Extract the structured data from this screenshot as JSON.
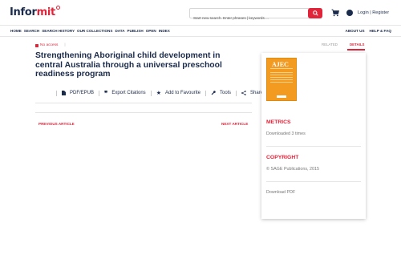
{
  "header": {
    "logo_part1": "Infor",
    "logo_part2": "mit",
    "search_placeholder": "Start new search. Enter phrases | keywords ...",
    "login_label": "Login | Register"
  },
  "nav": {
    "items": [
      "HOME",
      "SEARCH",
      "SEARCH HISTORY",
      "OUR COLLECTIONS",
      "DATA",
      "PUBLISH",
      "OPEN",
      "INDEX"
    ],
    "right_items": [
      "ABOUT US",
      "HELP & FAQ"
    ]
  },
  "article": {
    "access_label": "No access",
    "access_sep": "|",
    "title": "Strengthening Aboriginal child development in central Australia through a universal preschool readiness program",
    "tools": {
      "pdf": "PDF/EPUB",
      "export": "Export Citations",
      "favourite": "Add to Favourite",
      "tools": "Tools",
      "share": "Share"
    },
    "prev_label": "PREVIOUS ARTICLE",
    "next_label": "NEXT ARTICLE"
  },
  "sidebar": {
    "tab_related": "RELATED",
    "tab_details": "DETAILS",
    "cover_title": "AJEC",
    "metrics_heading": "METRICS",
    "metrics_value": "Downloaded 3 times",
    "copyright_heading": "COPYRIGHT",
    "copyright_value": "© SAGE Publications, 2015",
    "download_label": "Download PDF"
  },
  "colors": {
    "accent": "#e0243a",
    "navy": "#1b2b4b",
    "cover": "#f39a20"
  }
}
